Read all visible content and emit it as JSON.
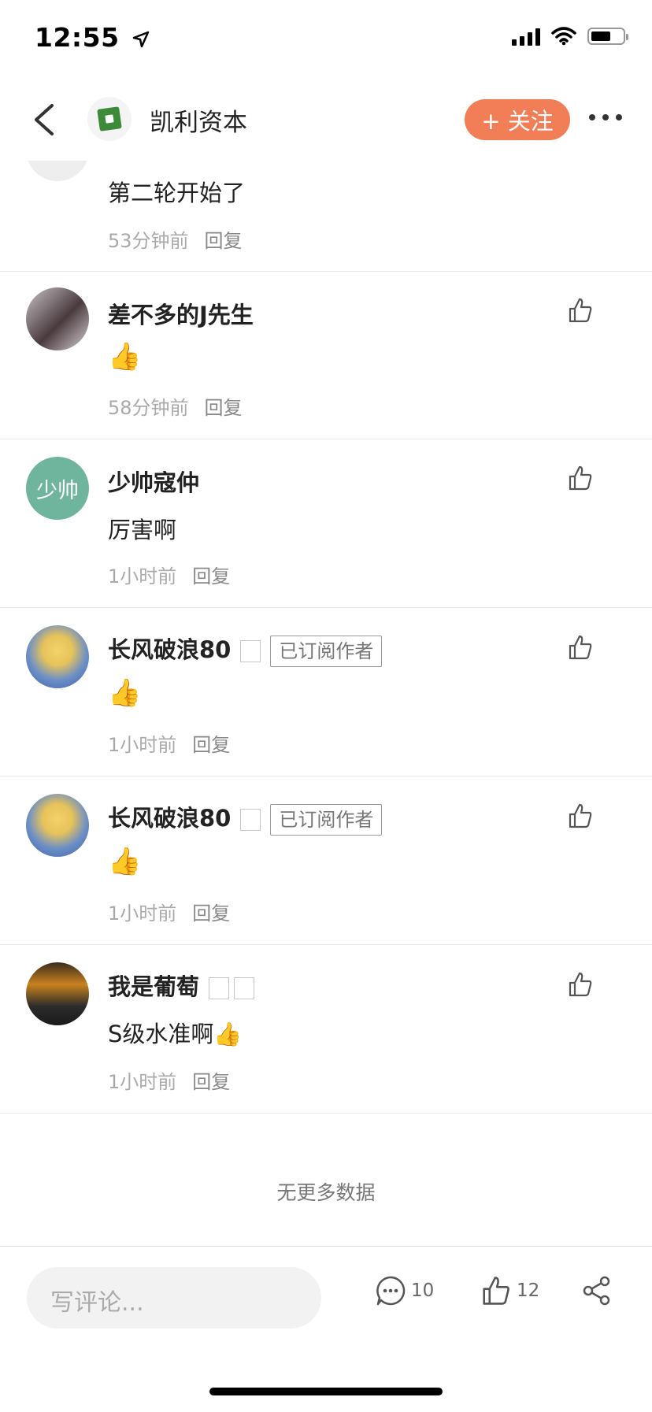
{
  "status_bar": {
    "time": "12:55"
  },
  "nav": {
    "account_name": "凯利资本",
    "follow_label": "+ 关注"
  },
  "comments": [
    {
      "name": "",
      "text": "第二轮开始了",
      "time": "53分钟前",
      "reply": "回复"
    },
    {
      "name": "差不多的J先生",
      "text": "👍",
      "time": "58分钟前",
      "reply": "回复"
    },
    {
      "name": "少帅寇仲",
      "avatar_text": "少帅",
      "text": "厉害啊",
      "time": "1小时前",
      "reply": "回复"
    },
    {
      "name": "长风破浪80",
      "badge": "已订阅作者",
      "text": "👍",
      "time": "1小时前",
      "reply": "回复"
    },
    {
      "name": "长风破浪80",
      "badge": "已订阅作者",
      "text": "👍",
      "time": "1小时前",
      "reply": "回复"
    },
    {
      "name": "我是葡萄",
      "text": "S级水准啊👍",
      "time": "1小时前",
      "reply": "回复"
    }
  ],
  "footer": {
    "no_more": "无更多数据"
  },
  "bottom_bar": {
    "input_placeholder": "写评论...",
    "comment_count": "10",
    "like_count": "12"
  },
  "colors": {
    "accent": "#f17e57",
    "avatar_green": "#6fb59d"
  }
}
